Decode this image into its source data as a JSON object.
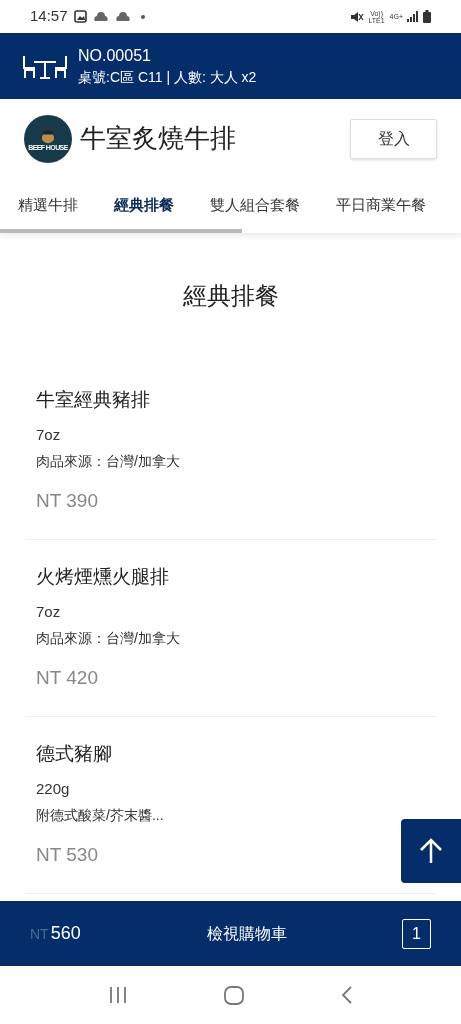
{
  "status_bar": {
    "time": "14:57",
    "network_top": "Vo)) LTE1",
    "network_type": "4G+"
  },
  "order_header": {
    "order_no": "NO.00051",
    "details": "桌號:C區 C11 | 人數: 大人 x2"
  },
  "brand": {
    "logo_text": "BEEF HOUSE",
    "name": "牛室炙燒牛排",
    "login_button": "登入"
  },
  "tabs": [
    {
      "label": "精選牛排",
      "selected": false
    },
    {
      "label": "經典排餐",
      "selected": true
    },
    {
      "label": "雙人組合套餐",
      "selected": false
    },
    {
      "label": "平日商業午餐",
      "selected": false
    }
  ],
  "section_title": "經典排餐",
  "menu_items": [
    {
      "name": "牛室經典豬排",
      "size": "7oz",
      "note": "肉品來源：台灣/加拿大",
      "price": "NT 390"
    },
    {
      "name": "火烤煙燻火腿排",
      "size": "7oz",
      "note": "肉品來源：台灣/加拿大",
      "price": "NT 420"
    },
    {
      "name": "德式豬腳",
      "size": "220g",
      "note": "附德式酸菜/芥末醬...",
      "price": "NT 530"
    }
  ],
  "cart_bar": {
    "currency": "NT",
    "total": "560",
    "label": "檢視購物車",
    "count": "1"
  }
}
